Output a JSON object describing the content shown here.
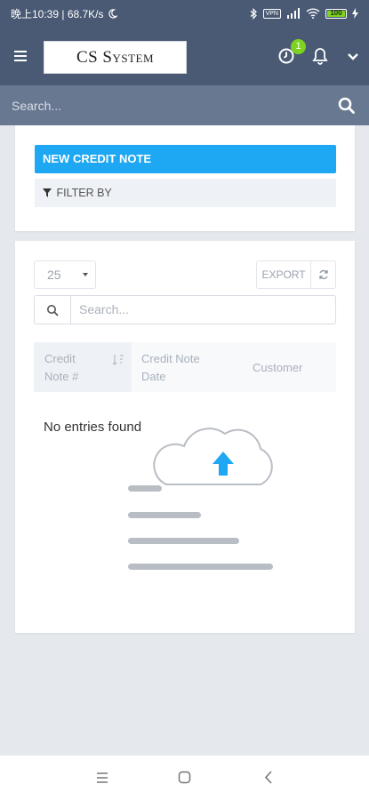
{
  "status_bar": {
    "left_text": "晚上10:39 | 68.7K/s",
    "network_box": "VPN",
    "battery_level": "100"
  },
  "header": {
    "logo_text": "CS System",
    "notification_count": "1"
  },
  "search": {
    "placeholder": "Search..."
  },
  "actions": {
    "new_credit_note_label": "New Credit Note",
    "filter_label": "Filter By"
  },
  "table": {
    "per_page_value": "25",
    "export_label": "Export",
    "search_placeholder": "Search...",
    "columns": [
      {
        "line1": "Credit",
        "line2": "Note #"
      },
      {
        "line1": "Credit Note",
        "line2": "Date"
      },
      {
        "line1": "Customer",
        "line2": ""
      }
    ],
    "empty_message": "No entries found"
  },
  "colors": {
    "header_bg": "#4a5a74",
    "searchbar_bg": "#687891",
    "primary_button": "#1ea7f2",
    "badge": "#7ed321"
  },
  "icons": [
    "menu-icon",
    "clock-icon",
    "bell-icon",
    "chevron-down-icon",
    "search-icon",
    "filter-icon",
    "refresh-icon",
    "cloud-upload-icon",
    "home-icon",
    "back-icon"
  ]
}
